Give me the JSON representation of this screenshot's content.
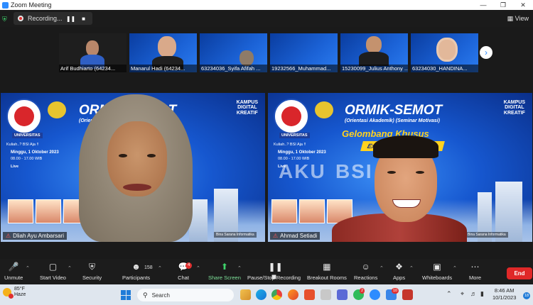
{
  "window": {
    "title": "Zoom Meeting"
  },
  "recording": {
    "label": "Recording...",
    "pause_icon": "pause-icon",
    "stop_icon": "stop-icon"
  },
  "view": {
    "label": "View"
  },
  "gallery": {
    "thumbnails": [
      {
        "name": "Arif Budhiarto (64234...",
        "style": "dark"
      },
      {
        "name": "Manarul Hadi (64234...",
        "style": "banner"
      },
      {
        "name": "63234036_Syifa Afifah ...",
        "style": "banner"
      },
      {
        "name": "19232566_Muhammad...",
        "style": "banner"
      },
      {
        "name": "15230099_Julius Anthony ...",
        "style": "banner"
      },
      {
        "name": "63234030_HANDINA...",
        "style": "banner"
      }
    ]
  },
  "banner": {
    "university": "UNIVERSITAS",
    "tagline": "Kuliah..? BSI Aja !!",
    "title": "ORMIK-SEMOT",
    "subtitle": "(Orientasi Akademik) (Seminar Motivasi)",
    "gelombang": "Gelombang Khusus",
    "explore": "Explore your Creativity",
    "kampus": [
      "KAMPUS",
      "DIGITAL",
      "KREATIF"
    ],
    "date": "Minggu, 1 Oktober 2023",
    "time": "08.00 - 17.00 WIB",
    "live": "Live",
    "aku": "AKU",
    "bsi": "BSI",
    "sarana": "Bina Sarana Informatika"
  },
  "speakers": [
    {
      "name": "Dliah Ayu Ambarsari"
    },
    {
      "name": "Ahmad Setiadi"
    }
  ],
  "toolbar": {
    "unmute": "Unmute",
    "start_video": "Start Video",
    "security": "Security",
    "participants": "Participants",
    "participants_count": "158",
    "chat": "Chat",
    "chat_badge": "4",
    "share_screen": "Share Screen",
    "pause_stop_recording": "Pause/Stop Recording",
    "breakout_rooms": "Breakout Rooms",
    "reactions": "Reactions",
    "apps": "Apps",
    "whiteboards": "Whiteboards",
    "more": "More",
    "end": "End"
  },
  "taskbar": {
    "weather_temp": "85°F",
    "weather_desc": "Haze",
    "search_placeholder": "Search",
    "time": "8:46 AM",
    "date": "10/1/2023",
    "notifications": "18",
    "whatsapp_badge": "2",
    "mail_badge": "10"
  },
  "colors": {
    "zoom_blue": "#2d8cff",
    "end_red": "#e02828",
    "share_green": "#3fd26b",
    "banner_blue": "#1657cf",
    "banner_yellow": "#ffd21f"
  }
}
